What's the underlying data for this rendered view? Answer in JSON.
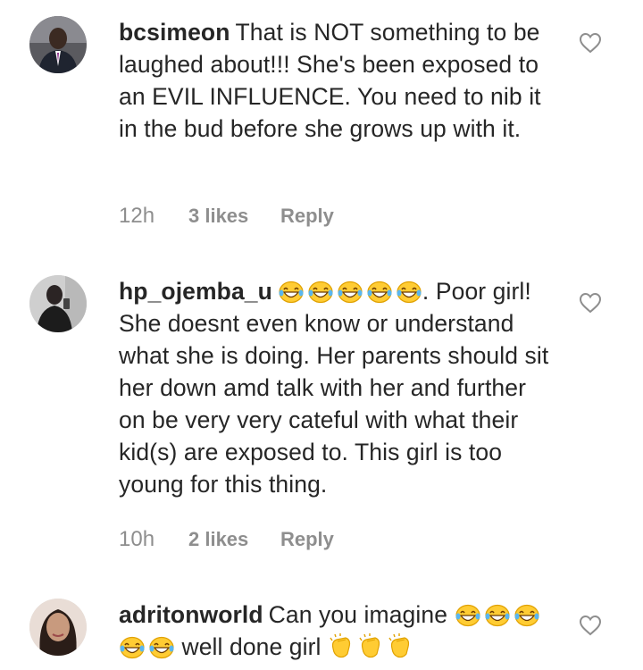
{
  "comments": [
    {
      "username": "bcsimeon",
      "text": "That is NOT something to be laughed about!!! She's been exposed to an EVIL INFLUENCE. You need to nib it in the bud before she grows up with it.",
      "time": "12h",
      "likes": "3 likes",
      "reply": "Reply",
      "avatar_icon": "profile-photo"
    },
    {
      "username": "hp_ojemba_u",
      "emoji_before": [
        "grinning-tears-emoji",
        "grinning-tears-emoji",
        "grinning-tears-emoji",
        "grinning-tears-emoji",
        "grinning-tears-emoji"
      ],
      "text": ". Poor girl! She doesnt even know or understand what she is doing. Her parents should sit her down amd talk with her and further on be very very cateful with what their kid(s) are exposed to. This girl is too young for this thing.",
      "time": "10h",
      "likes": "2 likes",
      "reply": "Reply",
      "avatar_icon": "profile-photo"
    },
    {
      "username": "adritonworld",
      "text_part1": "Can you imagine",
      "text_part2": "well done girl",
      "emoji_group1": [
        "grinning-tears-emoji",
        "grinning-tears-emoji",
        "grinning-tears-emoji",
        "grinning-tears-emoji",
        "grinning-tears-emoji"
      ],
      "emoji_group2": [
        "clapping-hands-emoji",
        "clapping-hands-emoji",
        "clapping-hands-emoji"
      ],
      "avatar_icon": "profile-photo"
    }
  ],
  "colors": {
    "text": "#262626",
    "meta": "#8e8e8e",
    "emoji_face": "#ffcc33",
    "emoji_outline": "#e0a100"
  }
}
